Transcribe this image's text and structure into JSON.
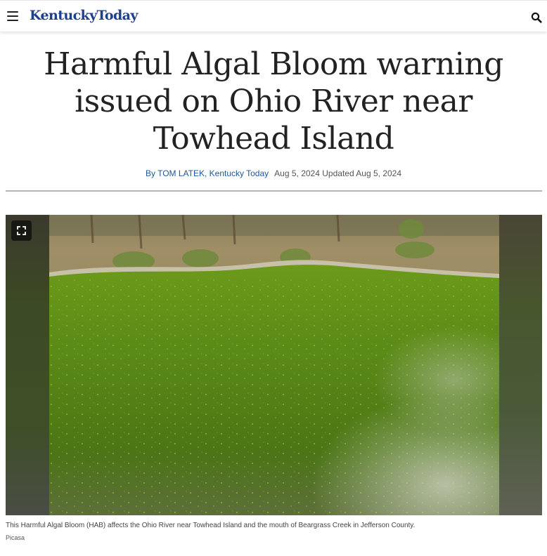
{
  "header": {
    "menu_icon": "hamburger-menu-icon",
    "logo_text": "KentuckyToday",
    "search_icon": "magnifier-search-icon",
    "brand_color": "#1e3f8f"
  },
  "article": {
    "headline": "Harmful Algal Bloom warning issued on Ohio River near Towhead Island",
    "byline": "By TOM LATEK, Kentucky Today",
    "published": "Aug 5, 2024",
    "updated": "Updated Aug 5, 2024"
  },
  "photo": {
    "expand_icon": "fullscreen-expand-icon",
    "caption": "This Harmful Algal Bloom (HAB) affects the Ohio River near Towhead Island and the mouth of Beargrass Creek in Jefferson County.",
    "credit": "Picasa"
  }
}
